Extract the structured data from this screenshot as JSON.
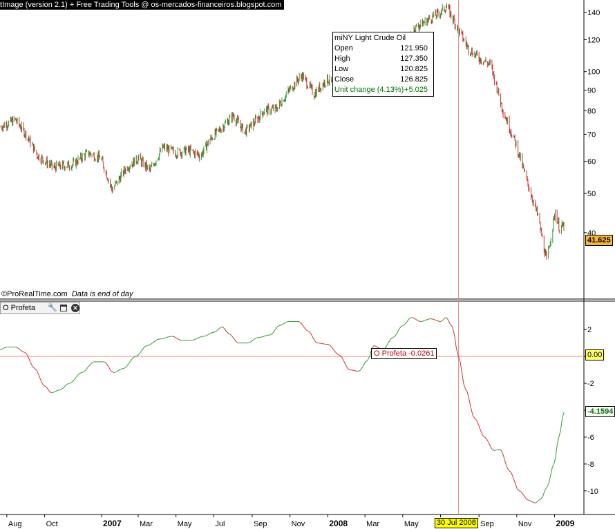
{
  "header": {
    "title": "tImage (version 2.1) + Free Trading Tools @ os-mercados-financeiros.blogspot.com"
  },
  "credit": {
    "site": "©ProRealTime.com",
    "note": "Data is end of day"
  },
  "indicator_panel": {
    "title": "O Profeta",
    "icons": [
      "wrench-icon",
      "window-icon",
      "close-icon"
    ]
  },
  "tooltip": {
    "instrument": "miNY Light Crude Oil",
    "rows": [
      {
        "label": "Open",
        "value": "121.950"
      },
      {
        "label": "High",
        "value": "127.350"
      },
      {
        "label": "Low",
        "value": "120.825"
      },
      {
        "label": "Close",
        "value": "126.825"
      }
    ],
    "change_label": "Unit change (4.13%)",
    "change_value": "+5.025"
  },
  "indicator_label": "O Profeta -0.0261",
  "badges": {
    "last_price": "41.625",
    "zero_line": "0.00",
    "indicator_last": "-4.1594"
  },
  "cursor_date": "30 Jul 2008",
  "colors": {
    "up": "#2f9a2f",
    "down": "#c83232",
    "crosshair": "#f08a8a",
    "axis": "#000000"
  },
  "chart_data": [
    {
      "type": "candlestick",
      "title": "miNY Light Crude Oil",
      "scale": "log",
      "ylim": [
        30,
        148
      ],
      "y_ticks": [
        40,
        50,
        60,
        70,
        80,
        90,
        100,
        120,
        140
      ],
      "x_ticks": [
        "Aug",
        "Oct",
        "2007",
        "Mar",
        "May",
        "Jul",
        "Sep",
        "Nov",
        "2008",
        "Mar",
        "May",
        "Jul",
        "Sep",
        "Nov",
        "2009"
      ],
      "x_range": [
        "2006-07-21",
        "2009-01-16"
      ],
      "close_path": [
        [
          "2006-07-21",
          73
        ],
        [
          "2006-08-15",
          76
        ],
        [
          "2006-09-01",
          70
        ],
        [
          "2006-09-20",
          62
        ],
        [
          "2006-10-15",
          58
        ],
        [
          "2006-11-15",
          59
        ],
        [
          "2006-12-10",
          63
        ],
        [
          "2006-12-31",
          61
        ],
        [
          "2007-01-18",
          51
        ],
        [
          "2007-02-10",
          58
        ],
        [
          "2007-03-01",
          61
        ],
        [
          "2007-03-20",
          57
        ],
        [
          "2007-04-10",
          65
        ],
        [
          "2007-05-01",
          63
        ],
        [
          "2007-05-20",
          64
        ],
        [
          "2007-06-10",
          62
        ],
        [
          "2007-06-25",
          68
        ],
        [
          "2007-07-15",
          73
        ],
        [
          "2007-08-01",
          78
        ],
        [
          "2007-08-20",
          71
        ],
        [
          "2007-09-01",
          74
        ],
        [
          "2007-09-20",
          80
        ],
        [
          "2007-10-10",
          81
        ],
        [
          "2007-10-31",
          90
        ],
        [
          "2007-11-20",
          98
        ],
        [
          "2007-12-10",
          88
        ],
        [
          "2007-12-31",
          96
        ],
        [
          "2008-01-20",
          90
        ],
        [
          "2008-02-10",
          95
        ],
        [
          "2008-03-01",
          102
        ],
        [
          "2008-03-20",
          101
        ],
        [
          "2008-04-10",
          110
        ],
        [
          "2008-05-01",
          114
        ],
        [
          "2008-05-20",
          128
        ],
        [
          "2008-06-10",
          134
        ],
        [
          "2008-06-30",
          140
        ],
        [
          "2008-07-11",
          145
        ],
        [
          "2008-07-30",
          126.8
        ],
        [
          "2008-08-15",
          114
        ],
        [
          "2008-09-01",
          108
        ],
        [
          "2008-09-20",
          104
        ],
        [
          "2008-10-10",
          80
        ],
        [
          "2008-10-31",
          66
        ],
        [
          "2008-11-20",
          52
        ],
        [
          "2008-12-05",
          44
        ],
        [
          "2008-12-19",
          34
        ],
        [
          "2009-01-02",
          45
        ],
        [
          "2009-01-09",
          41
        ],
        [
          "2009-01-16",
          41.625
        ]
      ],
      "series": [
        {
          "name": "miNY Light Crude Oil",
          "last_value": 41.625
        }
      ]
    },
    {
      "type": "line",
      "title": "O Profeta",
      "ylim": [
        -11.5,
        3.5
      ],
      "y_ticks": [
        -10,
        -8,
        -6,
        -4,
        -2,
        0,
        2
      ],
      "reference_line": 0,
      "x_range": [
        "2006-07-21",
        "2009-01-16"
      ],
      "series": [
        {
          "name": "O Profeta",
          "points": [
            [
              "2006-07-21",
              0.5
            ],
            [
              "2006-08-01",
              0.7
            ],
            [
              "2006-08-15",
              0.7
            ],
            [
              "2006-08-30",
              0.3
            ],
            [
              "2006-09-15",
              -0.9
            ],
            [
              "2006-10-01",
              -2.2
            ],
            [
              "2006-10-12",
              -2.7
            ],
            [
              "2006-10-25",
              -2.5
            ],
            [
              "2006-11-10",
              -2.0
            ],
            [
              "2006-11-30",
              -1.2
            ],
            [
              "2006-12-20",
              -0.4
            ],
            [
              "2007-01-05",
              -0.4
            ],
            [
              "2007-01-20",
              -1.2
            ],
            [
              "2007-02-05",
              -0.9
            ],
            [
              "2007-02-25",
              0
            ],
            [
              "2007-03-15",
              0.8
            ],
            [
              "2007-04-05",
              1.3
            ],
            [
              "2007-04-25",
              1.5
            ],
            [
              "2007-05-10",
              1.2
            ],
            [
              "2007-05-25",
              1.2
            ],
            [
              "2007-06-15",
              1.5
            ],
            [
              "2007-07-01",
              1.8
            ],
            [
              "2007-07-15",
              2.2
            ],
            [
              "2007-07-25",
              1.7
            ],
            [
              "2007-08-10",
              1.0
            ],
            [
              "2007-08-25",
              1.0
            ],
            [
              "2007-09-10",
              1.4
            ],
            [
              "2007-09-30",
              1.6
            ],
            [
              "2007-10-15",
              2.3
            ],
            [
              "2007-10-30",
              2.6
            ],
            [
              "2007-11-15",
              2.6
            ],
            [
              "2007-11-30",
              1.9
            ],
            [
              "2007-12-15",
              1.0
            ],
            [
              "2008-01-01",
              0.9
            ],
            [
              "2008-01-20",
              0.1
            ],
            [
              "2008-02-05",
              -1.0
            ],
            [
              "2008-02-20",
              -1.1
            ],
            [
              "2008-03-05",
              -0.3
            ],
            [
              "2008-03-15",
              0.8
            ],
            [
              "2008-03-30",
              0.5
            ],
            [
              "2008-04-15",
              1.4
            ],
            [
              "2008-05-01",
              2.3
            ],
            [
              "2008-05-15",
              2.9
            ],
            [
              "2008-05-30",
              2.6
            ],
            [
              "2008-06-15",
              2.8
            ],
            [
              "2008-07-01",
              2.6
            ],
            [
              "2008-07-10",
              2.9
            ],
            [
              "2008-07-20",
              2.2
            ],
            [
              "2008-07-30",
              -0.0261
            ],
            [
              "2008-08-10",
              -2.4
            ],
            [
              "2008-08-25",
              -4.6
            ],
            [
              "2008-09-10",
              -6.0
            ],
            [
              "2008-09-25",
              -7.0
            ],
            [
              "2008-10-05",
              -6.9
            ],
            [
              "2008-10-20",
              -8.5
            ],
            [
              "2008-11-05",
              -10.0
            ],
            [
              "2008-11-20",
              -10.7
            ],
            [
              "2008-12-01",
              -10.9
            ],
            [
              "2008-12-10",
              -10.6
            ],
            [
              "2008-12-20",
              -9.7
            ],
            [
              "2008-12-31",
              -8.0
            ],
            [
              "2009-01-08",
              -6.0
            ],
            [
              "2009-01-16",
              -4.1594
            ]
          ],
          "last_value": -4.1594
        }
      ]
    }
  ]
}
